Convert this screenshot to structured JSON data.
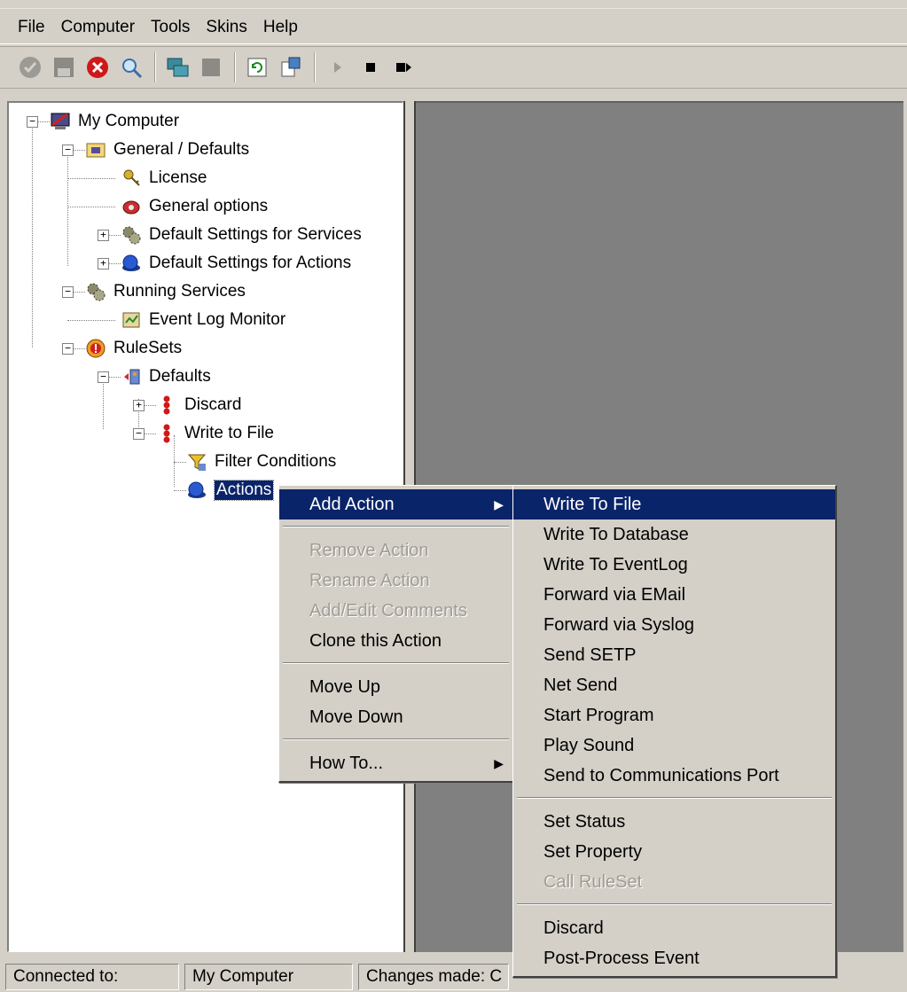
{
  "menubar": {
    "items": [
      "File",
      "Computer",
      "Tools",
      "Skins",
      "Help"
    ]
  },
  "toolbar": {
    "icons": [
      "check-icon",
      "save-icon",
      "cancel-icon",
      "search-icon",
      "connect-icon",
      "disconnect-icon",
      "refresh-icon",
      "config-icon",
      "play-icon",
      "stop-icon",
      "stop-next-icon"
    ]
  },
  "tree": {
    "root": "My Computer",
    "general": "General / Defaults",
    "license": "License",
    "general_options": "General options",
    "default_services": "Default Settings for Services",
    "default_actions": "Default Settings for Actions",
    "running_services": "Running Services",
    "event_log_monitor": "Event Log Monitor",
    "rulesets": "RuleSets",
    "defaults": "Defaults",
    "discard": "Discard",
    "write_to_file": "Write to File",
    "filter_conditions": "Filter Conditions",
    "actions": "Actions"
  },
  "context_menu": {
    "add_action": "Add Action",
    "remove_action": "Remove Action",
    "rename_action": "Rename Action",
    "add_edit_comments": "Add/Edit Comments",
    "clone_action": "Clone this Action",
    "move_up": "Move Up",
    "move_down": "Move Down",
    "how_to": "How To..."
  },
  "submenu": {
    "write_to_file": "Write To File",
    "write_to_database": "Write To Database",
    "write_to_eventlog": "Write To EventLog",
    "forward_email": "Forward via EMail",
    "forward_syslog": "Forward via Syslog",
    "send_setp": "Send SETP",
    "net_send": "Net Send",
    "start_program": "Start Program",
    "play_sound": "Play Sound",
    "send_comm_port": "Send to Communications Port",
    "set_status": "Set Status",
    "set_property": "Set Property",
    "call_ruleset": "Call RuleSet",
    "discard": "Discard",
    "post_process": "Post-Process Event"
  },
  "status": {
    "connected_label": "Connected to:",
    "computer": "My Computer",
    "changes": "Changes made: C"
  },
  "colors": {
    "highlight": "#0a246a",
    "face": "#d4d0c8",
    "right_panel": "#808080"
  }
}
